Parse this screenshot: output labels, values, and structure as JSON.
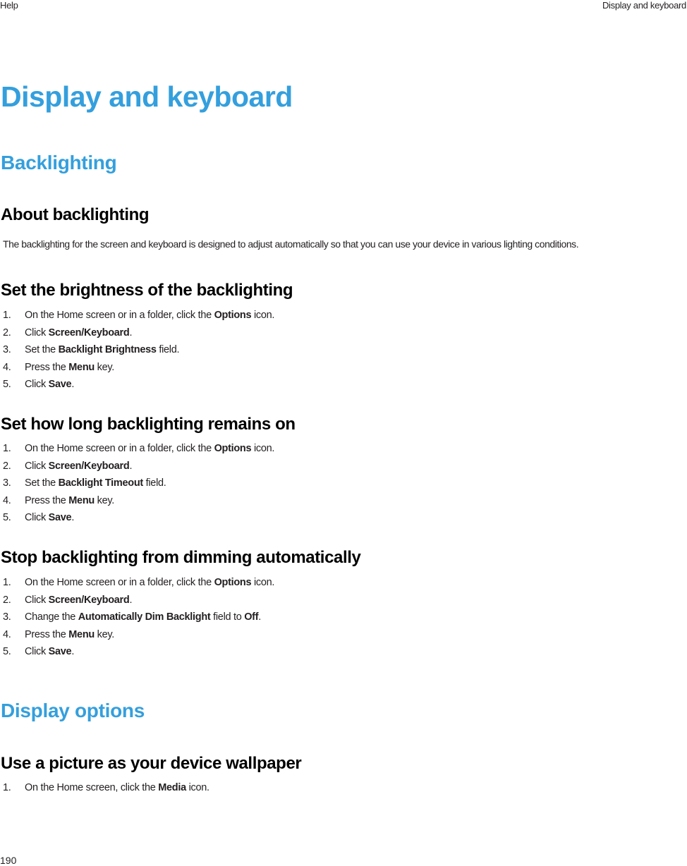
{
  "header": {
    "left": "Help",
    "right": "Display and keyboard"
  },
  "page_title": "Display and keyboard",
  "sections": [
    {
      "heading": "Backlighting",
      "topics": [
        {
          "title": "About backlighting",
          "paragraph": "The backlighting for the screen and keyboard is designed to adjust automatically so that you can use your device in various lighting conditions."
        },
        {
          "title": "Set the brightness of the backlighting",
          "steps": [
            {
              "num": "1.",
              "pre": "On the Home screen or in a folder, click the ",
              "bold": "Options",
              "post": " icon."
            },
            {
              "num": "2.",
              "pre": "Click ",
              "bold": "Screen/Keyboard",
              "post": "."
            },
            {
              "num": "3.",
              "pre": "Set the ",
              "bold": "Backlight Brightness",
              "post": " field."
            },
            {
              "num": "4.",
              "pre": "Press the ",
              "bold": "Menu",
              "post": " key."
            },
            {
              "num": "5.",
              "pre": "Click ",
              "bold": "Save",
              "post": "."
            }
          ]
        },
        {
          "title": "Set how long backlighting remains on",
          "steps": [
            {
              "num": "1.",
              "pre": "On the Home screen or in a folder, click the ",
              "bold": "Options",
              "post": " icon."
            },
            {
              "num": "2.",
              "pre": "Click ",
              "bold": "Screen/Keyboard",
              "post": "."
            },
            {
              "num": "3.",
              "pre": "Set the ",
              "bold": "Backlight Timeout",
              "post": " field."
            },
            {
              "num": "4.",
              "pre": "Press the ",
              "bold": "Menu",
              "post": " key."
            },
            {
              "num": "5.",
              "pre": "Click ",
              "bold": "Save",
              "post": "."
            }
          ]
        },
        {
          "title": "Stop backlighting from dimming automatically",
          "steps": [
            {
              "num": "1.",
              "pre": "On the Home screen or in a folder, click the ",
              "bold": "Options",
              "post": " icon."
            },
            {
              "num": "2.",
              "pre": "Click ",
              "bold": "Screen/Keyboard",
              "post": "."
            },
            {
              "num": "3.",
              "pre": "Change the ",
              "bold": "Automatically Dim Backlight",
              "post": " field to ",
              "bold2": "Off",
              "post2": "."
            },
            {
              "num": "4.",
              "pre": "Press the ",
              "bold": "Menu",
              "post": " key."
            },
            {
              "num": "5.",
              "pre": "Click ",
              "bold": "Save",
              "post": "."
            }
          ]
        }
      ]
    },
    {
      "heading": "Display options",
      "topics": [
        {
          "title": "Use a picture as your device wallpaper",
          "steps": [
            {
              "num": "1.",
              "pre": "On the Home screen, click the ",
              "bold": "Media",
              "post": " icon."
            }
          ]
        }
      ]
    }
  ],
  "footer": {
    "page_number": "190"
  },
  "colors": {
    "heading_blue": "#349fdd",
    "text": "#231f20"
  }
}
